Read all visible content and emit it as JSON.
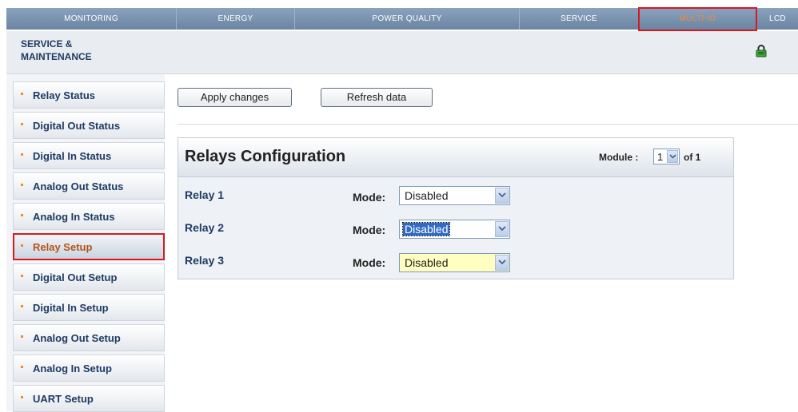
{
  "nav": {
    "tabs": [
      {
        "label": "MONITORING"
      },
      {
        "label": "ENERGY"
      },
      {
        "label": "POWER QUALITY"
      },
      {
        "label": "SERVICE"
      },
      {
        "label": "MULTI-IO"
      },
      {
        "label": "LCD"
      }
    ],
    "active_tab": "MULTI-IO"
  },
  "header": {
    "section_title_line1": "SERVICE &",
    "section_title_line2": "MAINTENANCE",
    "lock_icon": "lock-icon"
  },
  "sidebar": {
    "items": [
      {
        "label": "Relay Status"
      },
      {
        "label": "Digital Out Status"
      },
      {
        "label": "Digital In Status"
      },
      {
        "label": "Analog Out Status"
      },
      {
        "label": "Analog In Status"
      },
      {
        "label": "Relay Setup"
      },
      {
        "label": "Digital Out Setup"
      },
      {
        "label": "Digital In Setup"
      },
      {
        "label": "Analog Out Setup"
      },
      {
        "label": "Analog In Setup"
      },
      {
        "label": "UART Setup"
      }
    ],
    "active_item": "Relay Setup"
  },
  "actions": {
    "apply_label": "Apply changes",
    "refresh_label": "Refresh data"
  },
  "relays_panel": {
    "title": "Relays Configuration",
    "module_label": "Module :",
    "module_value": "1",
    "of_label": "of 1",
    "mode_label": "Mode:",
    "relays": [
      {
        "name": "Relay 1",
        "mode": "Disabled"
      },
      {
        "name": "Relay 2",
        "mode": "Disabled"
      },
      {
        "name": "Relay 3",
        "mode": "Disabled"
      }
    ]
  },
  "colors": {
    "nav_bg": "#7892b0",
    "active_tab_text": "#f28a3a",
    "highlight_border": "#d8191f",
    "sidebar_text": "#1f3b63",
    "active_sidebar_text": "#b4541a",
    "focus_select_bg": "#316ac5",
    "yellow_select_bg": "#ffffc2"
  }
}
